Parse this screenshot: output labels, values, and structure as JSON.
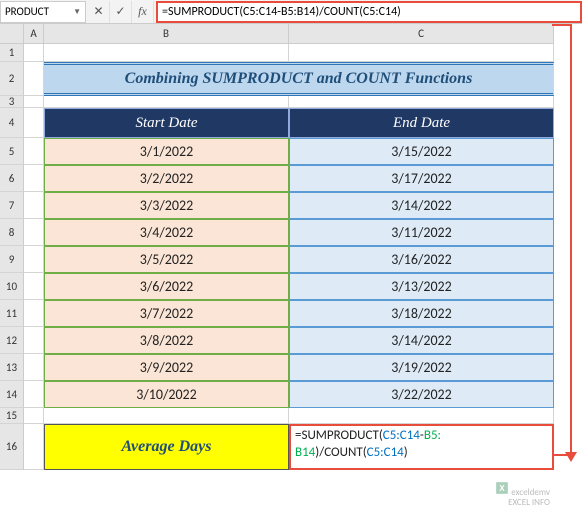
{
  "name_box": "PRODUCT",
  "formula_bar": "=SUMPRODUCT(C5:C14-B5:B14)/COUNT(C5:C14)",
  "columns": {
    "a": "A",
    "b": "B",
    "c": "C"
  },
  "rows": [
    "1",
    "2",
    "3",
    "4",
    "5",
    "6",
    "7",
    "8",
    "9",
    "10",
    "11",
    "12",
    "13",
    "14",
    "15",
    "16"
  ],
  "title": "Combining SUMPRODUCT and COUNT Functions",
  "headers": {
    "start": "Start  Date",
    "end": "End Date"
  },
  "data": [
    {
      "start": "3/1/2022",
      "end": "3/15/2022"
    },
    {
      "start": "3/2/2022",
      "end": "3/17/2022"
    },
    {
      "start": "3/3/2022",
      "end": "3/14/2022"
    },
    {
      "start": "3/4/2022",
      "end": "3/11/2022"
    },
    {
      "start": "3/5/2022",
      "end": "3/16/2022"
    },
    {
      "start": "3/6/2022",
      "end": "3/13/2022"
    },
    {
      "start": "3/7/2022",
      "end": "3/18/2022"
    },
    {
      "start": "3/8/2022",
      "end": "3/14/2022"
    },
    {
      "start": "3/9/2022",
      "end": "3/19/2022"
    },
    {
      "start": "3/10/2022",
      "end": "3/22/2022"
    }
  ],
  "avg_label": "Average Days",
  "cell_formula": {
    "p1": "=SUMPRODUCT(",
    "p2": "C5:C14",
    "p3": "-",
    "p4": "B5:",
    "p5": "B14",
    "p6": ")/COUNT(",
    "p7": "C5:C14",
    "p8": ")"
  },
  "watermark": {
    "l1": "exceldemv",
    "l2": "EXCEL INFO"
  }
}
